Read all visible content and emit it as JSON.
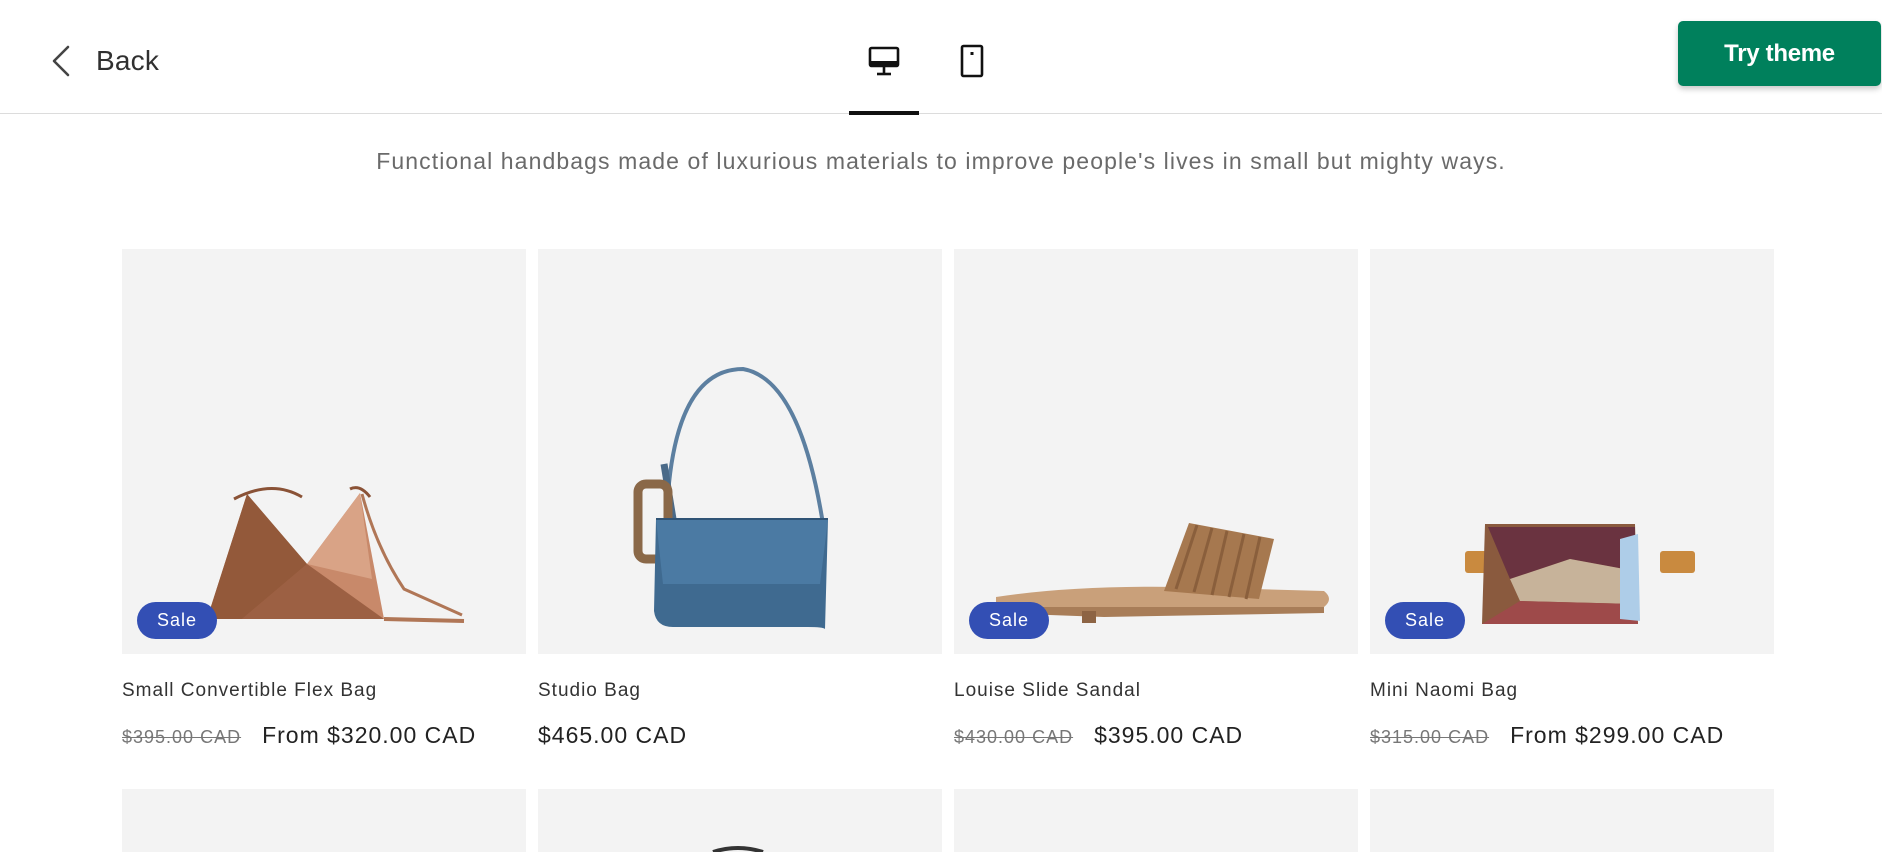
{
  "header": {
    "back_label": "Back",
    "try_label": "Try theme",
    "accent_color": "#00805c",
    "device_modes": [
      {
        "name": "desktop",
        "icon": "desktop-icon",
        "active": true
      },
      {
        "name": "mobile",
        "icon": "mobile-icon",
        "active": false
      }
    ]
  },
  "tagline": "Functional handbags made of luxurious materials to improve people's lives in small but mighty ways.",
  "sale_badge_color": "#334fb4",
  "products": [
    {
      "title": "Small Convertible Flex Bag",
      "badge": "Sale",
      "compare_price": "$395.00 CAD",
      "price": "From $320.00 CAD",
      "icon": "flex-bag-image"
    },
    {
      "title": "Studio Bag",
      "badge": "",
      "compare_price": "",
      "price": "$465.00 CAD",
      "icon": "studio-bag-image"
    },
    {
      "title": "Louise Slide Sandal",
      "badge": "Sale",
      "compare_price": "$430.00 CAD",
      "price": "$395.00 CAD",
      "icon": "sandal-image"
    },
    {
      "title": "Mini Naomi Bag",
      "badge": "Sale",
      "compare_price": "$315.00 CAD",
      "price": "From $299.00 CAD",
      "icon": "naomi-bag-image"
    }
  ]
}
